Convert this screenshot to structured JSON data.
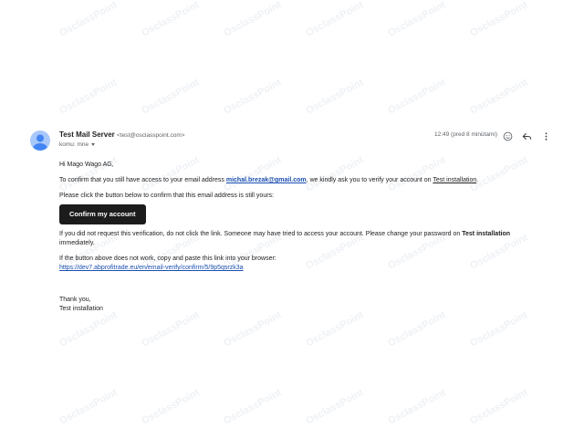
{
  "watermark_text": "OsclassPoint",
  "sender": {
    "name": "Test Mail Server",
    "email": "<test@osclasspoint.com>"
  },
  "recipient": {
    "label": "komu: mne"
  },
  "meta": {
    "time": "12:49 (pred 8 minútami)"
  },
  "body": {
    "greeting": "Hi Mago Wago AG,",
    "p1_before": "To confirm that you still have access to your email address ",
    "p1_email": "michal.brezak@gmail.com",
    "p1_middle": ", we kindly ask you to verify your account on ",
    "p1_site": "Test installation",
    "p1_end": ".",
    "p2": "Please click the button below to confirm that this email address is still yours:",
    "button_label": "Confirm my account",
    "p3_before": "If you did not request this verification, do not click the link. Someone may have tried to access your account. Please change your password on ",
    "p3_site": "Test installation",
    "p3_end": " immediately.",
    "p4": "If the button above does not work, copy and paste this link into your browser:",
    "verify_url": "https://dev7.abprofitrade.eu/en/email-verify/confirm/5/9p5qsrzk3a",
    "thanks": "Thank you,",
    "signature": "Test installation"
  },
  "icons": {
    "avatar": "person-avatar-icon",
    "emoji": "emoji-react-icon",
    "reply": "reply-icon",
    "more": "more-vertical-icon"
  },
  "colors": {
    "link": "#1a4fb0",
    "button_bg": "#1c1c1c",
    "avatar_bg": "#a8c7fa"
  }
}
